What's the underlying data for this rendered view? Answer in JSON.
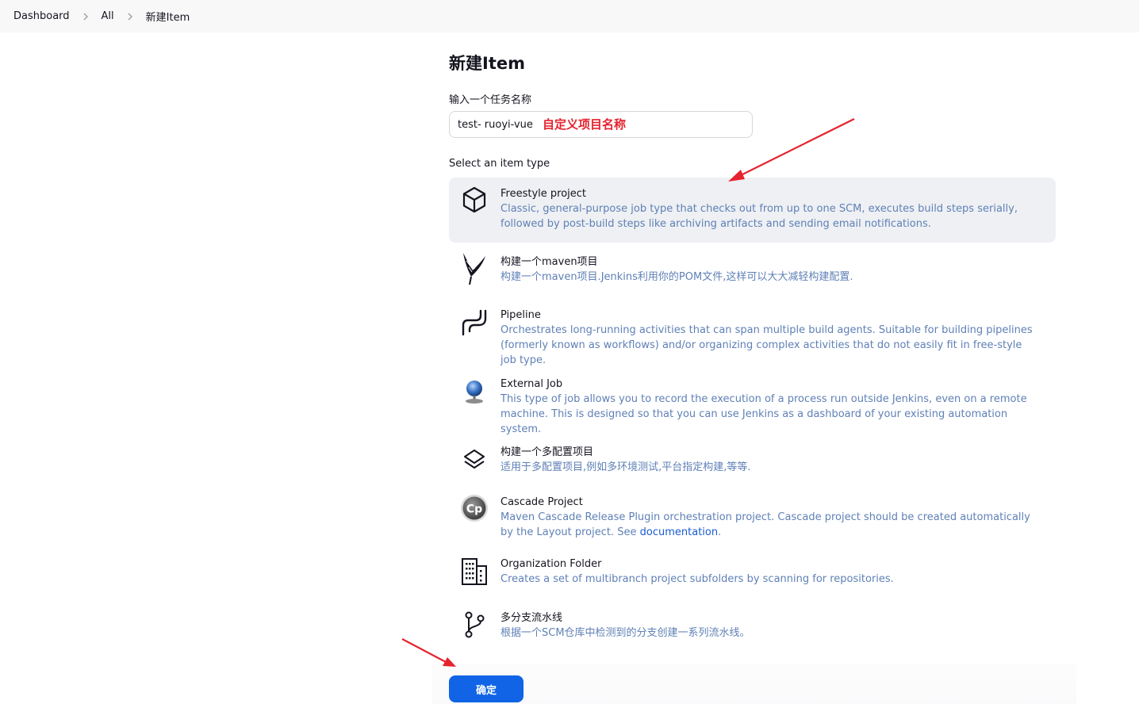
{
  "breadcrumb": {
    "items": [
      "Dashboard",
      "All",
      "新建Item"
    ]
  },
  "page": {
    "title": "新建Item",
    "name_label": "输入一个任务名称",
    "name_value": "test- ruoyi-vue",
    "annotation": "自定义项目名称",
    "type_label": "Select an item type"
  },
  "item_types": [
    {
      "title": "Freestyle project",
      "desc": "Classic, general-purpose job type that checks out from up to one SCM, executes build steps serially, followed by post-build steps like archiving artifacts and sending email notifications.",
      "icon": "cube-icon",
      "selected": true
    },
    {
      "title": "构建一个maven项目",
      "desc": "构建一个maven项目.Jenkins利用你的POM文件,这样可以大大减轻构建配置.",
      "icon": "feather-icon"
    },
    {
      "title": "Pipeline",
      "desc": "Orchestrates long-running activities that can span multiple build agents. Suitable for building pipelines (formerly known as workflows) and/or organizing complex activities that do not easily fit in free-style job type.",
      "icon": "pipeline-icon"
    },
    {
      "title": "External Job",
      "desc": "This type of job allows you to record the execution of a process run outside Jenkins, even on a remote machine. This is designed so that you can use Jenkins as a dashboard of your existing automation system.",
      "icon": "globe-icon"
    },
    {
      "title": "构建一个多配置项目",
      "desc": "适用于多配置项目,例如多环境测试,平台指定构建,等等.",
      "icon": "layers-icon"
    },
    {
      "title": "Cascade Project",
      "desc_before": "Maven Cascade Release Plugin orchestration project. Cascade project should be created automatically by the Layout project. See ",
      "desc_link": "documentation",
      "desc_after": ".",
      "icon": "cascade-icon",
      "icon_text": "Cp"
    },
    {
      "title": "Organization Folder",
      "desc": "Creates a set of multibranch project subfolders by scanning for repositories.",
      "icon": "building-icon"
    },
    {
      "title": "多分支流水线",
      "desc": "根据一个SCM仓库中检测到的分支创建一系列流水线。",
      "icon": "branch-icon"
    }
  ],
  "footer": {
    "ok_label": "确定"
  },
  "colors": {
    "accent": "#1064e5",
    "annotation_red": "#e5232e",
    "desc_text": "#5f80b6",
    "selected_bg": "#eef0f3"
  }
}
